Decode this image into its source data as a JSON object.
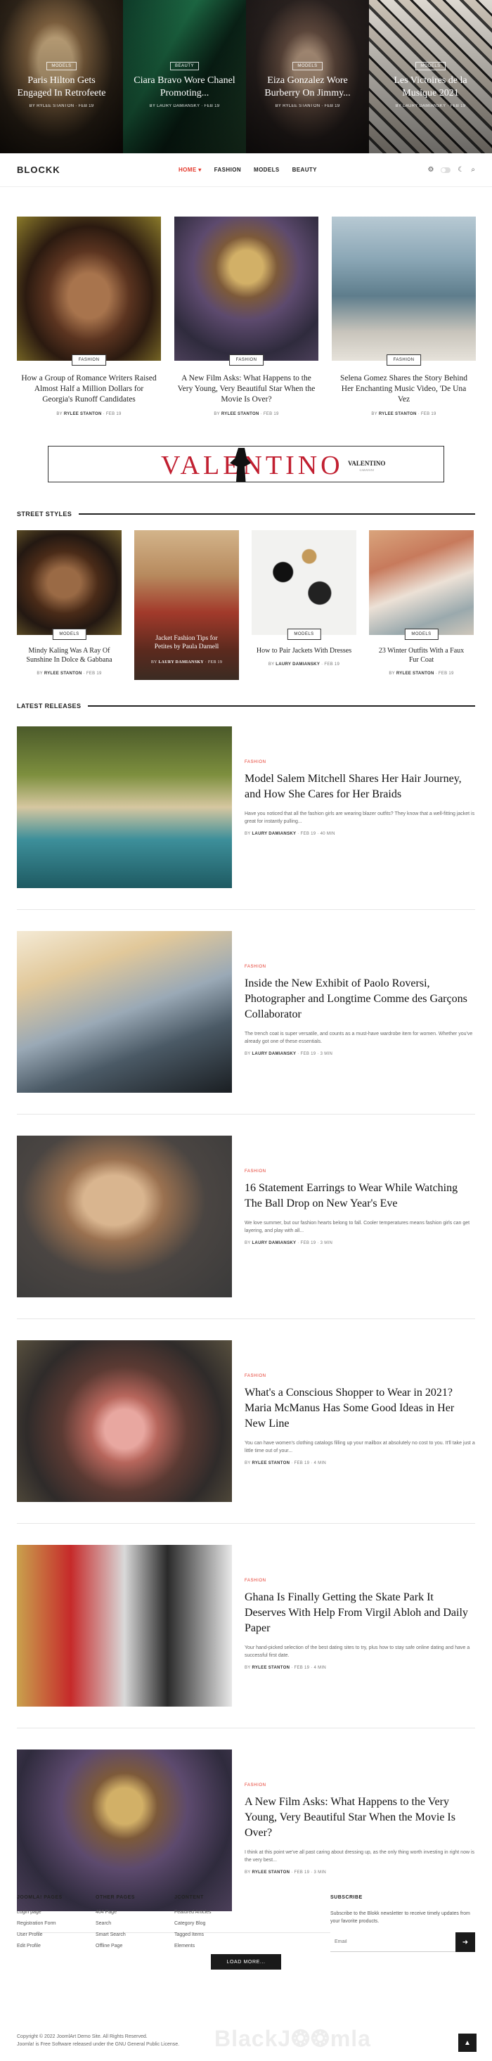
{
  "hero": [
    {
      "category": "Models",
      "title": "Paris Hilton Gets Engaged In Retrofeete",
      "author": "RYLEE STANTON",
      "date": "FEB 19"
    },
    {
      "category": "Beauty",
      "title": "Ciara Bravo Wore Chanel Promoting...",
      "author": "LAURY DAMIANSKY",
      "date": "FEB 19"
    },
    {
      "category": "Models",
      "title": "Eiza Gonzalez Wore Burberry On Jimmy...",
      "author": "RYLEE STANTON",
      "date": "FEB 19"
    },
    {
      "category": "Models",
      "title": "Les Victoires de la Musique 2021",
      "author": "LAURY DAMIANSKY",
      "date": "FEB 19"
    }
  ],
  "header": {
    "logo": "BLOCKK",
    "nav": [
      "HOME ▾",
      "FASHION",
      "MODELS",
      "BEAUTY"
    ],
    "icons": [
      "gear-icon",
      "toggle-icon",
      "moon-icon",
      "search-icon"
    ]
  },
  "featured": [
    {
      "category": "Fashion",
      "title": "How a Group of Romance Writers Raised Almost Half a Million Dollars for Georgia's Runoff Candidates",
      "author": "RYLEE STANTON",
      "date": "FEB 19"
    },
    {
      "category": "Fashion",
      "title": "A New Film Asks: What Happens to the Very Young, Very Beautiful Star When the Movie Is Over?",
      "author": "RYLEE STANTON",
      "date": "FEB 19"
    },
    {
      "category": "Fashion",
      "title": "Selena Gomez Shares the Story Behind Her Enchanting Music Video, 'De Una Vez",
      "author": "RYLEE STANTON",
      "date": "FEB 19"
    }
  ],
  "ad": {
    "brand": "VALENTINO",
    "small": "VALENTINO",
    "small_sub": "GARAVANI"
  },
  "street": {
    "heading": "STREET STYLES",
    "items": [
      {
        "category": "Models",
        "title": "Mindy Kaling Was A Ray Of Sunshine In Dolce & Gabbana",
        "author": "RYLEE STANTON",
        "date": "FEB 19"
      },
      {
        "category": "",
        "title": "Jacket Fashion Tips for Petites by Paula Darnell",
        "author": "LAURY DAMIANSKY",
        "date": "FEB 19"
      },
      {
        "category": "Models",
        "title": "How to Pair Jackets With Dresses",
        "author": "LAURY DAMIANSKY",
        "date": "FEB 19"
      },
      {
        "category": "Models",
        "title": "23 Winter Outfits With a Faux Fur Coat",
        "author": "RYLEE STANTON",
        "date": "FEB 19"
      }
    ]
  },
  "latest": {
    "heading": "LATEST RELEASES",
    "items": [
      {
        "category": "Fashion",
        "title": "Model Salem Mitchell Shares Her Hair Journey, and How She Cares for Her Braids",
        "excerpt": "Have you noticed that all the fashion girls are wearing blazer outfits? They know that a well-fitting jacket is great for instantly pulling...",
        "author": "LAURY DAMIANSKY",
        "date": "FEB 19",
        "reads": "40 MIN"
      },
      {
        "category": "Fashion",
        "title": "Inside the New Exhibit of Paolo Roversi, Photographer and Longtime Comme des Garçons Collaborator",
        "excerpt": "The trench coat is super versatile, and counts as a must-have wardrobe item for women. Whether you've already got one of these essentials.",
        "author": "LAURY DAMIANSKY",
        "date": "FEB 19",
        "reads": "3 MIN"
      },
      {
        "category": "Fashion",
        "title": "16 Statement Earrings to Wear While Watching The Ball Drop on New Year's Eve",
        "excerpt": "We love summer, but our fashion hearts belong to fall. Cooler temperatures means fashion girls can get layering, and play with all...",
        "author": "LAURY DAMIANSKY",
        "date": "FEB 19",
        "reads": "3 MIN"
      },
      {
        "category": "Fashion",
        "title": "What's a Conscious Shopper to Wear in 2021? Maria McManus Has Some Good Ideas in Her New Line",
        "excerpt": "You can have women's clothing catalogs filling up your mailbox at absolutely no cost to you. It'll take just a little time out of your...",
        "author": "RYLEE STANTON",
        "date": "FEB 19",
        "reads": "4 MIN"
      },
      {
        "category": "Fashion",
        "title": "Ghana Is Finally Getting the Skate Park It Deserves With Help From Virgil Abloh and Daily Paper",
        "excerpt": "Your hand-picked selection of the best dating sites to try, plus how to stay safe online dating and have a successful first date.",
        "author": "RYLEE STANTON",
        "date": "FEB 19",
        "reads": "4 MIN"
      },
      {
        "category": "Fashion",
        "title": "A New Film Asks: What Happens to the Very Young, Very Beautiful Star When the Movie Is Over?",
        "excerpt": "I think at this point we've all past caring about dressing up, as the only thing worth investing in right now is the very best...",
        "author": "RYLEE STANTON",
        "date": "FEB 19",
        "reads": "3 MIN"
      }
    ],
    "load_more": "LOAD MORE..."
  },
  "footer": {
    "columns": [
      {
        "title": "JOOMLA! PAGES",
        "links": [
          "Login page",
          "Registration Form",
          "User Profile",
          "Edit Profile"
        ]
      },
      {
        "title": "OTHER PAGES",
        "links": [
          "404 Page",
          "Search",
          "Smart Search",
          "Offline Page"
        ]
      },
      {
        "title": "JCONTENT",
        "links": [
          "Featured Articles",
          "Category Blog",
          "Tagged Items",
          "Elements"
        ]
      }
    ],
    "subscribe": {
      "title": "SUBSCRIBE",
      "text": "Subscribe to the Blokk newsletter to receive timely updates from your favorite products.",
      "placeholder": "Email",
      "button": "➜"
    },
    "copyright_1": "Copyright © 2022 JoomlArt Demo Site. All Rights Reserved.",
    "copyright_2": "Joomla! is Free Software released under the GNU General Public License.",
    "watermark": "BlackJ❂❂mla",
    "to_top": "▲"
  },
  "colors": {
    "accent": "#e4382b",
    "brand_ad": "#c11f30",
    "dark": "#1a1a1a"
  }
}
